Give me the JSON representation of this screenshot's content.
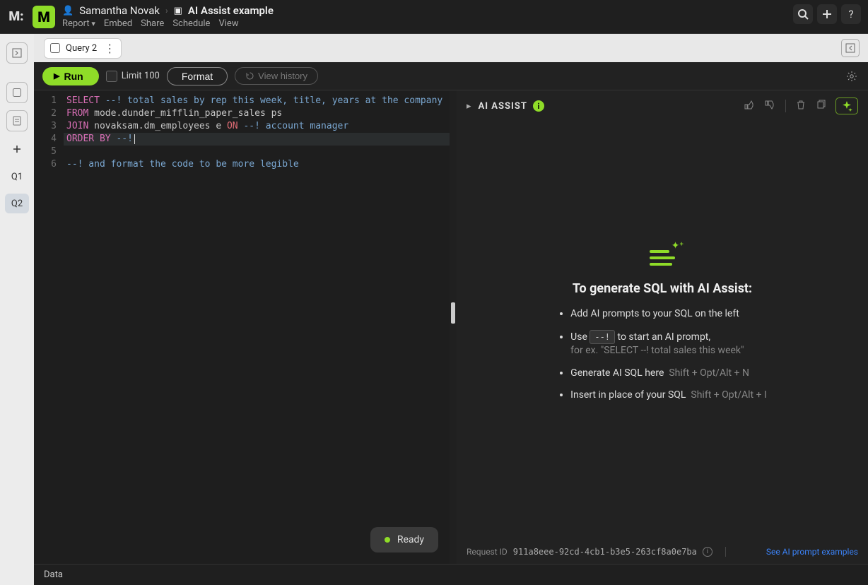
{
  "header": {
    "user": "Samantha Novak",
    "title": "AI Assist example",
    "menu": [
      "Report",
      "Embed",
      "Share",
      "Schedule",
      "View"
    ]
  },
  "leftRail": {
    "q1": "Q1",
    "q2": "Q2"
  },
  "tabbar": {
    "tab": "Query 2"
  },
  "toolbar": {
    "run": "Run",
    "limit": "Limit 100",
    "format": "Format",
    "history": "View history"
  },
  "editor": {
    "lineNos": [
      "1",
      "2",
      "3",
      "4",
      "5",
      "6"
    ],
    "l1": {
      "k": "SELECT",
      "rest": " --! total sales by rep this week, title, years at the company"
    },
    "l2": {
      "k": "FROM",
      "rest": " mode.dunder_mifflin_paper_sales ps"
    },
    "l3": {
      "k1": "JOIN",
      "mid": " novaksam.dm_employees e ",
      "k2": "ON",
      "rest": " --! account manager"
    },
    "l4": {
      "k": "ORDER BY",
      "rest": " --!"
    },
    "l5": "",
    "l6": "--! and format the code to be more legible"
  },
  "assist": {
    "title": "AI ASSIST",
    "heading": "To generate SQL with AI Assist:",
    "b1": "Add AI prompts to your SQL on the left",
    "b2a": "Use ",
    "b2kbd": "--!",
    "b2b": " to start an AI prompt,",
    "b2c": "for ex. \"SELECT --! total sales this week\"",
    "b3": "Generate AI SQL here",
    "b3s": "Shift + Opt/Alt + N",
    "b4": "Insert in place of your SQL",
    "b4s": "Shift + Opt/Alt + I",
    "ridLabel": "Request ID",
    "ridVal": "911a8eee-92cd-4cb1-b3e5-263cf8a0e7ba",
    "link": "See AI prompt examples"
  },
  "ready": "Ready",
  "bottom": {
    "data": "Data"
  }
}
